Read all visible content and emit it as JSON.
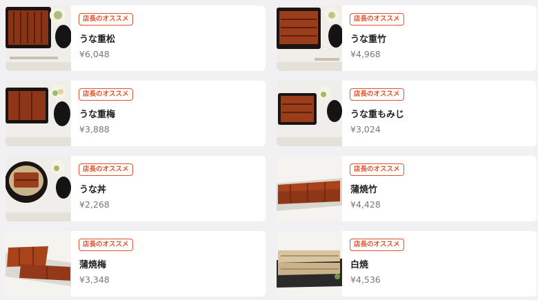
{
  "items": [
    {
      "badge": "店長のオススメ",
      "name": "うな重松",
      "price": "¥6,048",
      "image": "unaju-box-large"
    },
    {
      "badge": "店長のオススメ",
      "name": "うな重竹",
      "price": "¥4,968",
      "image": "unaju-box"
    },
    {
      "badge": "店長のオススメ",
      "name": "うな重梅",
      "price": "¥3,888",
      "image": "unaju-box"
    },
    {
      "badge": "店長のオススメ",
      "name": "うな重もみじ",
      "price": "¥3,024",
      "image": "unaju-box-small"
    },
    {
      "badge": "店長のオススメ",
      "name": "うな丼",
      "price": "¥2,268",
      "image": "unadon-bowl"
    },
    {
      "badge": "店長のオススメ",
      "name": "蒲焼竹",
      "price": "¥4,428",
      "image": "kabayaki-plate"
    },
    {
      "badge": "店長のオススメ",
      "name": "蒲焼梅",
      "price": "¥3,348",
      "image": "kabayaki-plate"
    },
    {
      "badge": "店長のオススメ",
      "name": "白焼",
      "price": "¥4,536",
      "image": "shirayaki-plate"
    }
  ],
  "colors": {
    "badge": "#e0532c",
    "background": "#f1f1f3",
    "card": "#ffffff"
  }
}
